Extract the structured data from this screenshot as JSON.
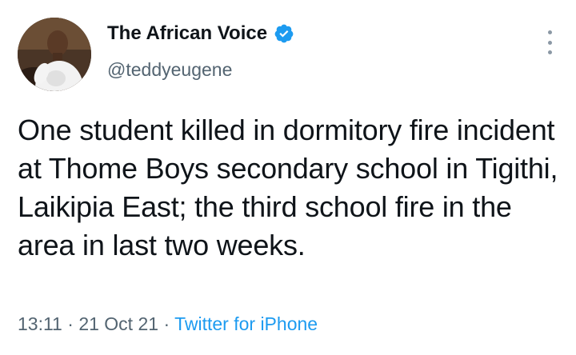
{
  "author": {
    "display_name": "The African Voice",
    "handle": "@teddyeugene",
    "verified": true,
    "verified_color": "#1d9bf0"
  },
  "tweet": {
    "text": "One student killed in dormitory fire incident at Thome Boys secondary school in Tigithi, Laikipia East; the third school fire in the area in last two weeks.",
    "time": "13:11",
    "separator": "·",
    "date": "21 Oct 21",
    "source": "Twitter for iPhone"
  },
  "icons": {
    "verified": "verified-badge-icon",
    "more": "more-vertical-icon"
  },
  "colors": {
    "text": "#0f1419",
    "secondary": "#536471",
    "link": "#1d9bf0"
  }
}
